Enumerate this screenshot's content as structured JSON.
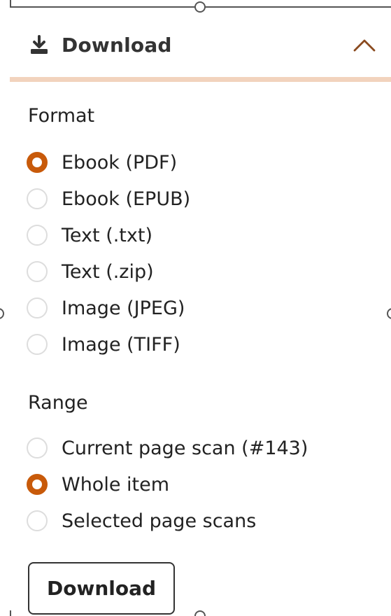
{
  "panel": {
    "title": "Download",
    "title_icon": "download-icon",
    "collapse_icon": "chevron-up-icon",
    "accent_color": "#f2d3bd",
    "expanded": true
  },
  "format": {
    "label": "Format",
    "options": [
      {
        "label": "Ebook (PDF)",
        "selected": true
      },
      {
        "label": "Ebook (EPUB)",
        "selected": false
      },
      {
        "label": "Text (.txt)",
        "selected": false
      },
      {
        "label": "Text (.zip)",
        "selected": false
      },
      {
        "label": "Image (JPEG)",
        "selected": false
      },
      {
        "label": "Image (TIFF)",
        "selected": false
      }
    ]
  },
  "range": {
    "label": "Range",
    "options": [
      {
        "label": "Current page scan (#143)",
        "selected": false
      },
      {
        "label": "Whole item",
        "selected": true
      },
      {
        "label": "Selected page scans",
        "selected": false
      }
    ]
  },
  "actions": {
    "download_label": "Download"
  },
  "colors": {
    "radio_selected": "#c85a0a",
    "radio_unselected_border": "#dddddd",
    "text": "#222222"
  }
}
